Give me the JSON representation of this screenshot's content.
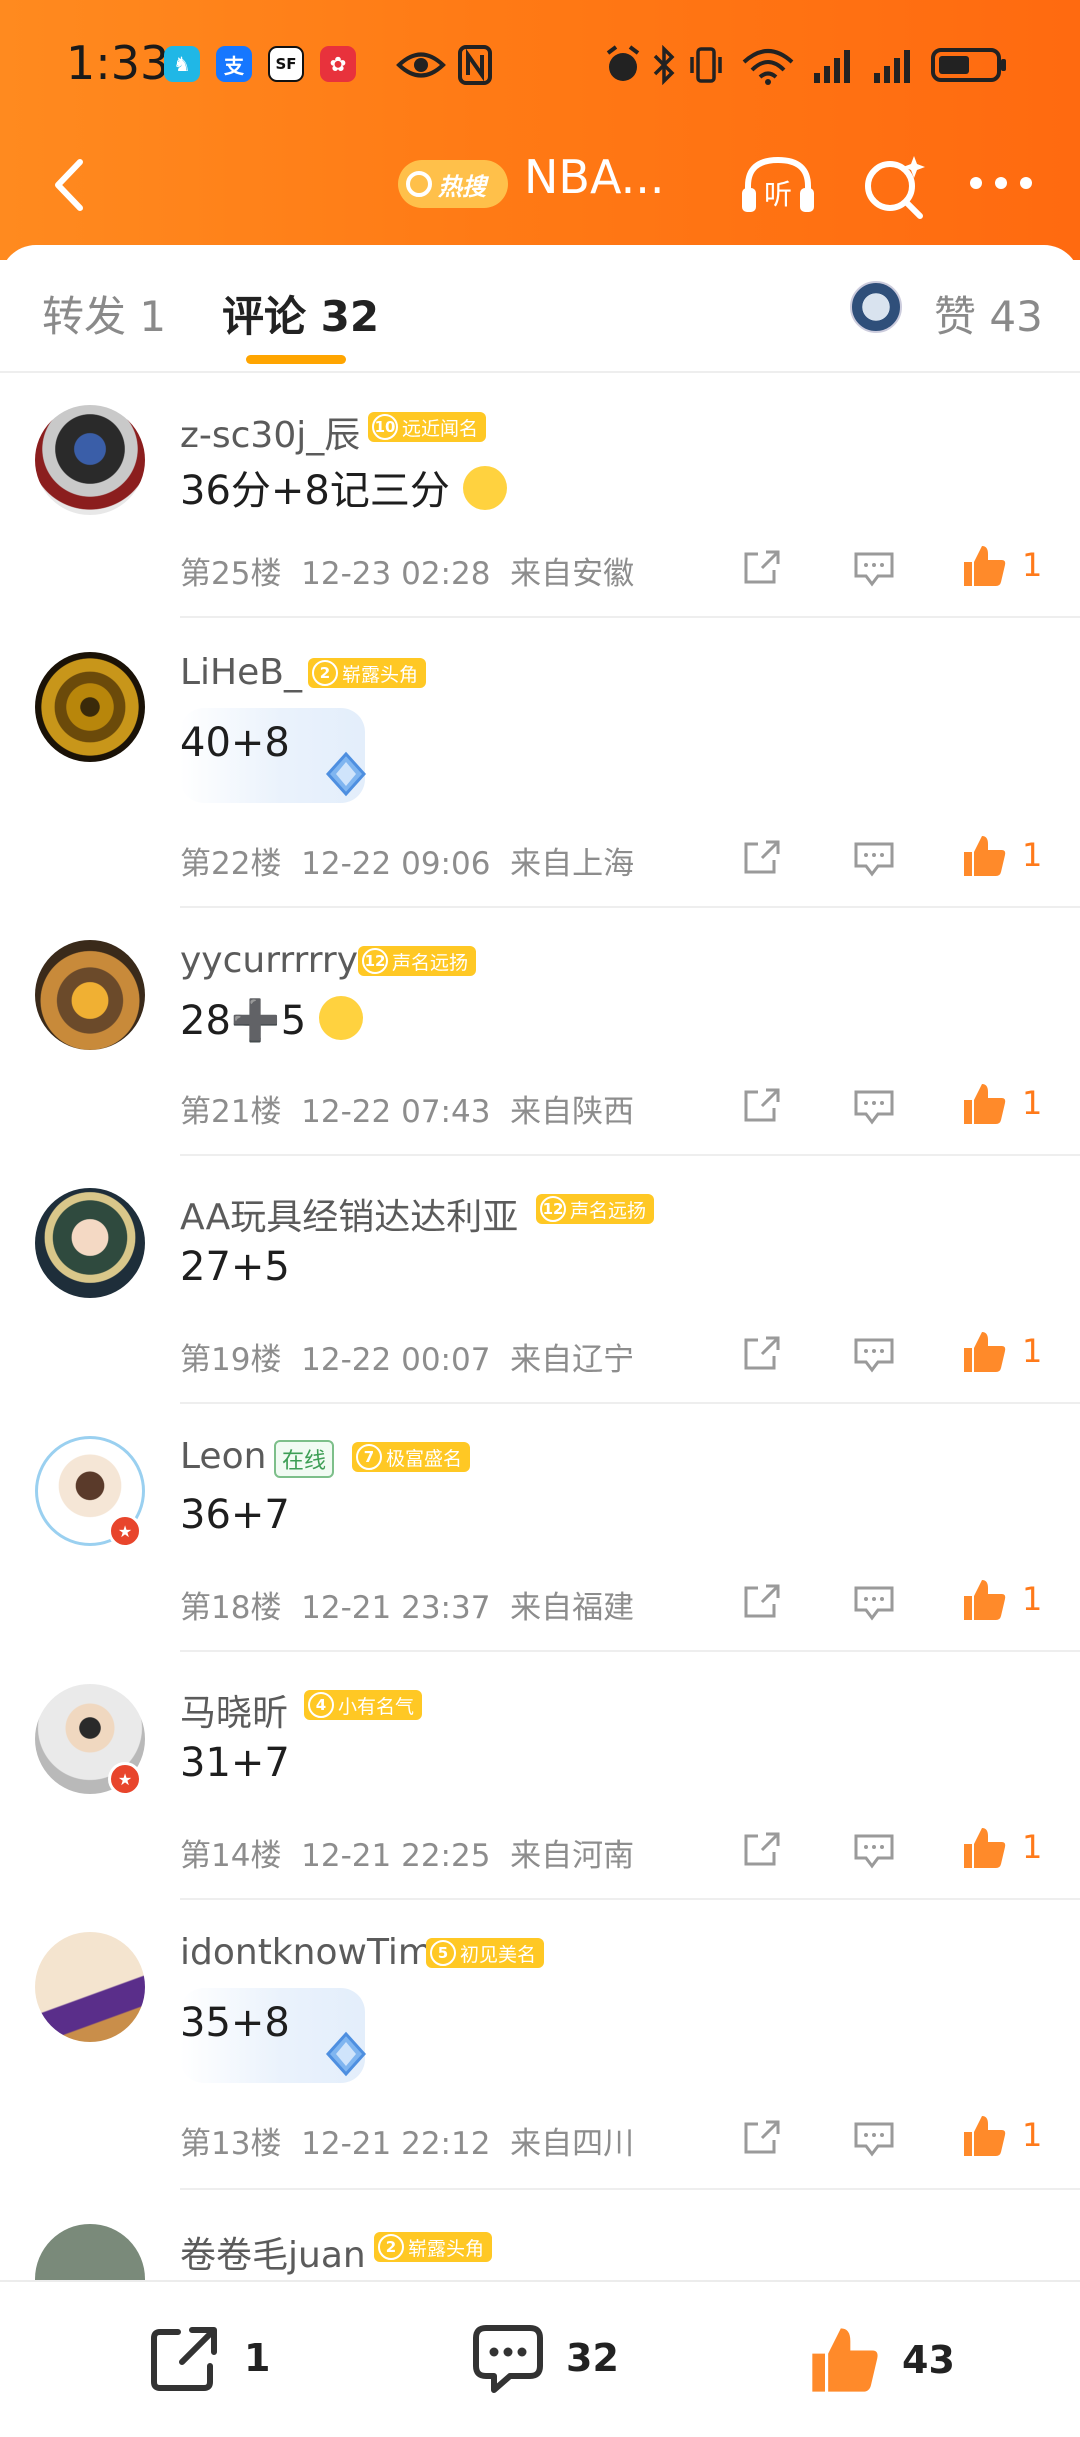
{
  "status_bar": {
    "time": "1:33",
    "apps": [
      {
        "name": "camel-app-icon",
        "glyph": "🐫",
        "color": "#20b7e6"
      },
      {
        "name": "alipay-icon",
        "glyph": "支",
        "color": "#1677ff"
      },
      {
        "name": "sf-express-icon",
        "glyph": "SF",
        "color": "#ffffff"
      },
      {
        "name": "gift-app-icon",
        "glyph": "✿",
        "color": "#e8323c"
      }
    ]
  },
  "navbar": {
    "hot_label": "热搜",
    "title": "NBA...",
    "listen_label": "听"
  },
  "tabs": {
    "repost": "转发 1",
    "comment": "评论 32",
    "like": "赞 43"
  },
  "comments": [
    {
      "user": "z-sc30j_辰",
      "level": "10",
      "level_title": "远近闻名",
      "text": "36分+8记三分",
      "floor": "第25楼",
      "date": "12-23 02:28",
      "location": "来自安徽",
      "likes": "1"
    },
    {
      "user": "LiHeB_",
      "level": "2",
      "level_title": "崭露头角",
      "text": "40+8",
      "floor": "第22楼",
      "date": "12-22 09:06",
      "location": "来自上海",
      "likes": "1"
    },
    {
      "user": "yycurrrrry",
      "level": "12",
      "level_title": "声名远扬",
      "text": "28➕5",
      "floor": "第21楼",
      "date": "12-22 07:43",
      "location": "来自陕西",
      "likes": "1"
    },
    {
      "user": "AA玩具经销达达利亚",
      "level": "12",
      "level_title": "声名远扬",
      "text": "27+5",
      "floor": "第19楼",
      "date": "12-22 00:07",
      "location": "来自辽宁",
      "likes": "1"
    },
    {
      "user": "Leon",
      "online": "在线",
      "level": "7",
      "level_title": "极富盛名",
      "text": "36+7",
      "floor": "第18楼",
      "date": "12-21 23:37",
      "location": "来自福建",
      "likes": "1"
    },
    {
      "user": "马晓昕",
      "level": "4",
      "level_title": "小有名气",
      "text": "31+7",
      "floor": "第14楼",
      "date": "12-21 22:25",
      "location": "来自河南",
      "likes": "1"
    },
    {
      "user": "idontknowTim",
      "level": "5",
      "level_title": "初见美名",
      "text": "35+8",
      "floor": "第13楼",
      "date": "12-21 22:12",
      "location": "来自四川",
      "likes": "1"
    },
    {
      "user": "卷卷毛juan",
      "level": "2",
      "level_title": "崭露头角"
    }
  ],
  "bottom_bar": {
    "repost_count": "1",
    "comment_count": "32",
    "like_count": "43"
  },
  "colors": {
    "header_orange": "#ff7a15",
    "accent_orange": "#ff7a1a",
    "level_badge": "#ffc824",
    "tab_underline": "#ffa500"
  }
}
